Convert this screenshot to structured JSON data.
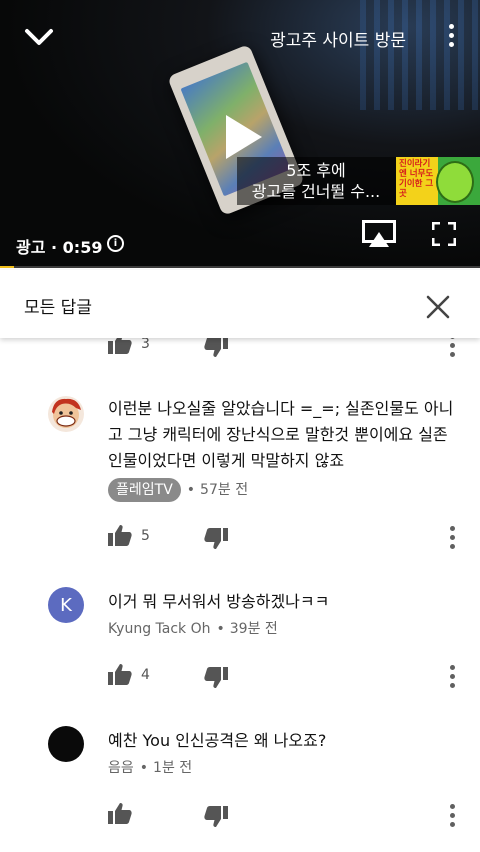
{
  "player": {
    "visit_label": "광고주 사이트 방문",
    "skip_line1": "5조 후에",
    "skip_line2": "광고를 건너뛸 수...",
    "skip_thumb_text": "진이라기엔 너무도 기이한 그 곳",
    "ad_label": "광고 · 0:59",
    "progress_fraction": 0.03,
    "progress_color": "#f2c01b",
    "icons": [
      "chevron-down-icon",
      "more-vert-icon",
      "play-icon",
      "info-icon",
      "cast-icon",
      "fullscreen-icon"
    ]
  },
  "panel": {
    "title": "모든 답글",
    "close_icon": "close-icon"
  },
  "partial_row": {
    "likes": "3"
  },
  "comments": [
    {
      "text": "이런분 나오실줄 알았습니다 =_=; 실존인물도 아니고 그냥 캐릭터에 장난식으로 말한것 뿐이에요 실존 인물이었다면 이렇게 막말하지 않죠",
      "author": "플레임TV",
      "author_is_chip": true,
      "time": "57분 전",
      "likes": "5",
      "avatar": "cartoon-avatar"
    },
    {
      "text": "이거 뭐 무서워서 방송하겠나ㅋㅋ",
      "author": "Kyung Tack Oh",
      "time": "39분 전",
      "likes": "4",
      "avatar_letter": "K",
      "avatar_color": "#5c6bc0"
    },
    {
      "text": "예찬 You 인신공격은 왜 나오죠?",
      "author": "음음",
      "time": "1분 전",
      "likes": "",
      "avatar_color": "#0a0a0a"
    }
  ]
}
